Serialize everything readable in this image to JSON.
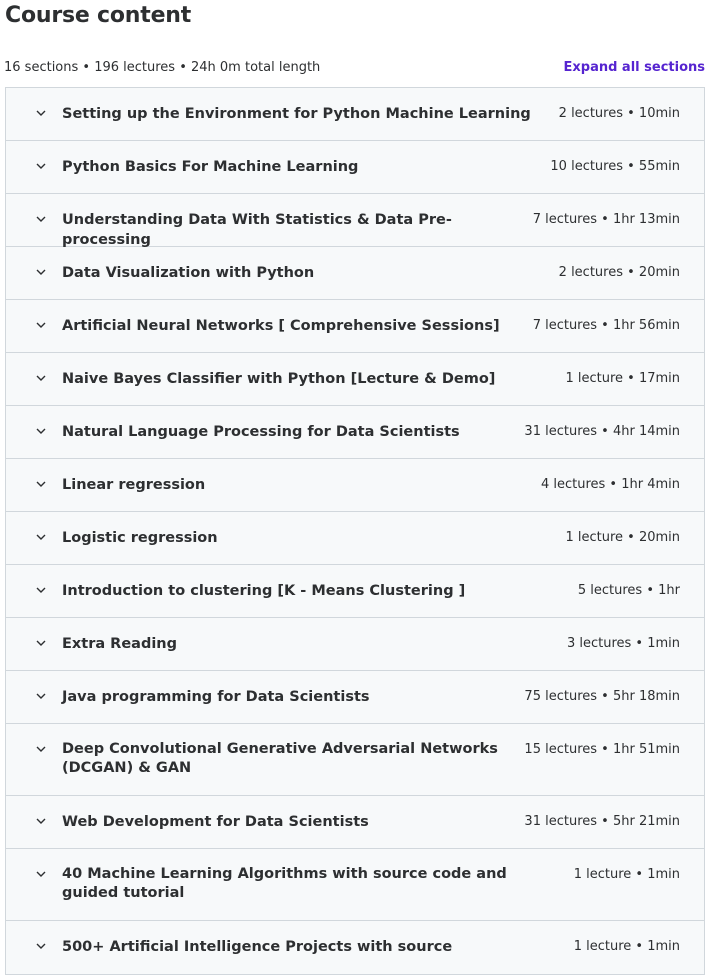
{
  "header": {
    "title": "Course content",
    "meta": "16 sections • 196 lectures • 24h 0m total length",
    "expand_label": "Expand all sections"
  },
  "sections": [
    {
      "title": "Setting up the Environment for Python Machine Learning",
      "info": "2 lectures • 10min"
    },
    {
      "title": "Python Basics For Machine Learning",
      "info": "10 lectures • 55min"
    },
    {
      "title": "Understanding Data With Statistics & Data Pre-processing",
      "info": "7 lectures • 1hr 13min"
    },
    {
      "title": "Data Visualization with Python",
      "info": "2 lectures • 20min"
    },
    {
      "title": "Artificial Neural Networks [ Comprehensive Sessions]",
      "info": "7 lectures • 1hr 56min"
    },
    {
      "title": "Naive Bayes Classifier with Python [Lecture & Demo]",
      "info": "1 lecture • 17min"
    },
    {
      "title": "Natural Language Processing for Data Scientists",
      "info": "31 lectures • 4hr 14min"
    },
    {
      "title": "Linear regression",
      "info": "4 lectures • 1hr 4min"
    },
    {
      "title": "Logistic regression",
      "info": "1 lecture • 20min"
    },
    {
      "title": "Introduction to clustering [K - Means Clustering ]",
      "info": "5 lectures • 1hr"
    },
    {
      "title": "Extra Reading",
      "info": "3 lectures • 1min"
    },
    {
      "title": "Java programming for Data Scientists",
      "info": "75 lectures • 5hr 18min"
    },
    {
      "title": "Deep Convolutional Generative Adversarial Networks (DCGAN) & GAN",
      "info": "15 lectures • 1hr 51min"
    },
    {
      "title": "Web Development for Data Scientists",
      "info": "31 lectures • 5hr 21min"
    },
    {
      "title": "40 Machine Learning Algorithms with source code and guided tutorial",
      "info": "1 lecture • 1min"
    },
    {
      "title": "500+ Artificial Intelligence Projects with source",
      "info": "1 lecture • 1min"
    }
  ],
  "icons": {
    "expand_chevron": "chevron-down-icon"
  },
  "colors": {
    "accent": "#5624d0",
    "row_bg": "#f7f9fa",
    "border": "#d1d7dc",
    "text": "#2d2f31"
  }
}
